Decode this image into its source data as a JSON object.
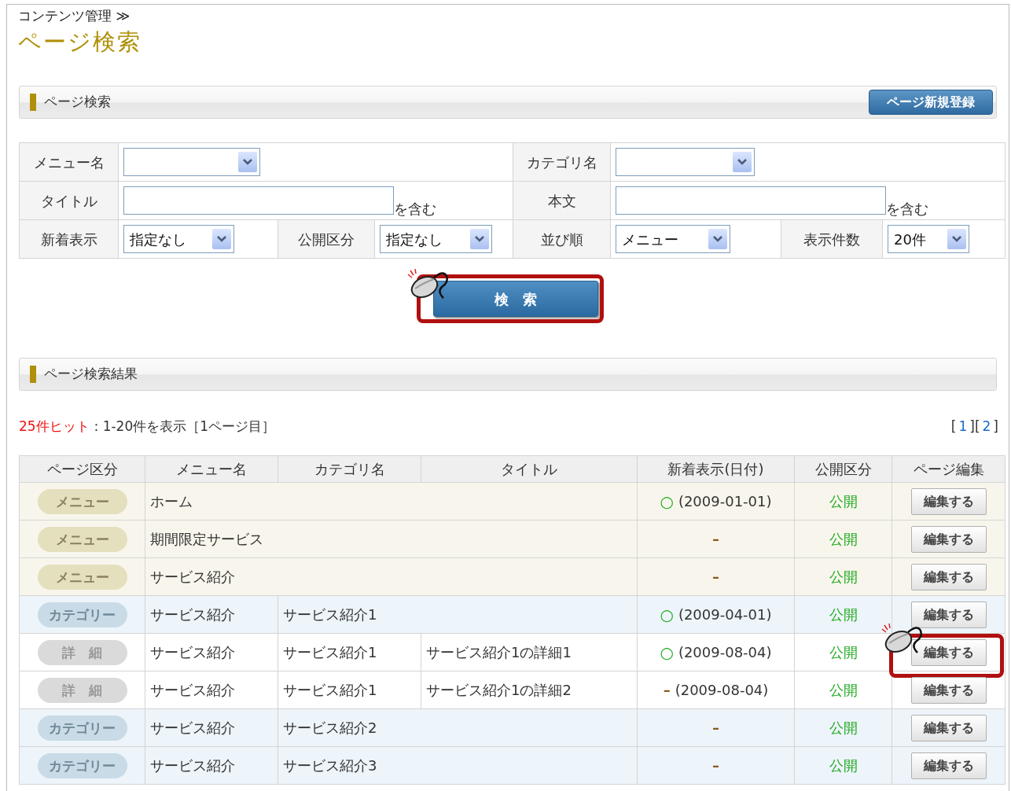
{
  "breadcrumb": "コンテンツ管理 ≫",
  "page_title": "ページ検索",
  "search_section": {
    "heading": "ページ検索",
    "new_button": "ページ新規登録"
  },
  "search_form": {
    "menu_label": "メニュー名",
    "category_label": "カテゴリ名",
    "title_label": "タイトル",
    "title_suffix": "を含む",
    "body_label": "本文",
    "body_suffix": "を含む",
    "new_label": "新着表示",
    "new_value": "指定なし",
    "public_label": "公開区分",
    "public_value": "指定なし",
    "order_label": "並び順",
    "order_value": "メニュー",
    "count_label": "表示件数",
    "count_value": "20件"
  },
  "search_button": {
    "label": "検　索",
    "highlighted": true
  },
  "results_section": {
    "heading": "ページ検索結果"
  },
  "summary": {
    "hits": "25件ヒット",
    "text": "：1-20件を表示［1ページ目］"
  },
  "pagination": [
    {
      "kind": "text",
      "text": "["
    },
    {
      "kind": "link",
      "text": "1"
    },
    {
      "kind": "text",
      "text": "]["
    },
    {
      "kind": "link",
      "text": "2"
    },
    {
      "kind": "text",
      "text": "]"
    }
  ],
  "columns": [
    "ページ区分",
    "メニュー名",
    "カテゴリ名",
    "タイトル",
    "新着表示(日付)",
    "公開区分",
    "ページ編集"
  ],
  "rows": [
    {
      "kind": "menu",
      "type": "メニュー",
      "menu": "ホーム",
      "new_mark": "○",
      "new_on": true,
      "new_date": "(2009-01-01)",
      "status": "公開",
      "edit": "編集する",
      "highlighted": false
    },
    {
      "kind": "menu",
      "type": "メニュー",
      "menu": "期間限定サービス",
      "new_mark": "–",
      "new_on": false,
      "status": "公開",
      "edit": "編集する",
      "highlighted": false
    },
    {
      "kind": "menu",
      "type": "メニュー",
      "menu": "サービス紹介",
      "new_mark": "–",
      "new_on": false,
      "status": "公開",
      "edit": "編集する",
      "highlighted": false
    },
    {
      "kind": "category",
      "type": "カテゴリー",
      "menu": "サービス紹介",
      "category": "サービス紹介1",
      "new_mark": "○",
      "new_on": true,
      "new_date": "(2009-04-01)",
      "status": "公開",
      "edit": "編集する",
      "highlighted": false
    },
    {
      "kind": "detail",
      "type": "詳　細",
      "menu": "サービス紹介",
      "category": "サービス紹介1",
      "title": "サービス紹介1の詳細1",
      "new_mark": "○",
      "new_on": true,
      "new_date": "(2009-08-04)",
      "status": "公開",
      "edit": "編集する",
      "highlighted": true
    },
    {
      "kind": "detail",
      "type": "詳　細",
      "menu": "サービス紹介",
      "category": "サービス紹介1",
      "title": "サービス紹介1の詳細2",
      "new_mark": "–",
      "new_on": false,
      "new_date": "(2009-08-04)",
      "status": "公開",
      "edit": "編集する",
      "highlighted": false
    },
    {
      "kind": "category",
      "type": "カテゴリー",
      "menu": "サービス紹介",
      "category": "サービス紹介2",
      "new_mark": "–",
      "new_on": false,
      "status": "公開",
      "edit": "編集する",
      "highlighted": false
    },
    {
      "kind": "category",
      "type": "カテゴリー",
      "menu": "サービス紹介",
      "category": "サービス紹介3",
      "new_mark": "–",
      "new_on": false,
      "status": "公開",
      "edit": "編集する",
      "highlighted": false
    }
  ]
}
